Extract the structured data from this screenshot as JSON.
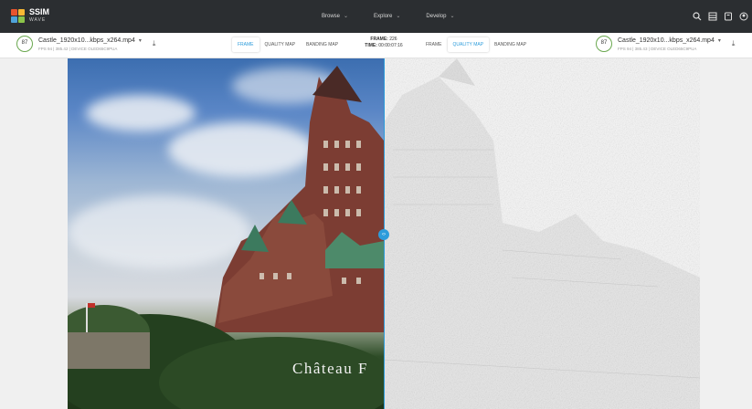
{
  "app": {
    "brand_top": "SSIM",
    "brand_bottom": "WAVE"
  },
  "nav": [
    {
      "label": "Browse"
    },
    {
      "label": "Explore"
    },
    {
      "label": "Develop"
    }
  ],
  "top_icons": [
    "search-icon",
    "list-icon",
    "book-icon",
    "user-icon"
  ],
  "left_file": {
    "score": "87",
    "name": "Castle_1920x10...kbps_x264.mp4",
    "meta": "FPS 94  |  385.42  |  DEVICE OLED65C9PUA"
  },
  "right_file": {
    "score": "87",
    "name": "Castle_1920x10...kbps_x264.mp4",
    "meta": "FPS 94  |  385.43  |  DEVICE OLED65C9PUA"
  },
  "left_tabs": [
    {
      "label": "FRAME",
      "active": true
    },
    {
      "label": "QUALITY MAP",
      "active": false
    },
    {
      "label": "BANDING MAP",
      "active": false
    }
  ],
  "right_tabs": [
    {
      "label": "FRAME",
      "active": false
    },
    {
      "label": "QUALITY MAP",
      "active": true
    },
    {
      "label": "BANDING MAP",
      "active": false
    }
  ],
  "frame_info": {
    "frame_label": "FRAME:",
    "frame_value": "226",
    "time_label": "TIME:",
    "time_value": "00:00:07:16"
  },
  "viewer": {
    "caption": "Château F"
  },
  "colors": {
    "accent": "#2d9cdb",
    "topbar": "#2b2e31",
    "score_ring": "#6aa84f"
  }
}
